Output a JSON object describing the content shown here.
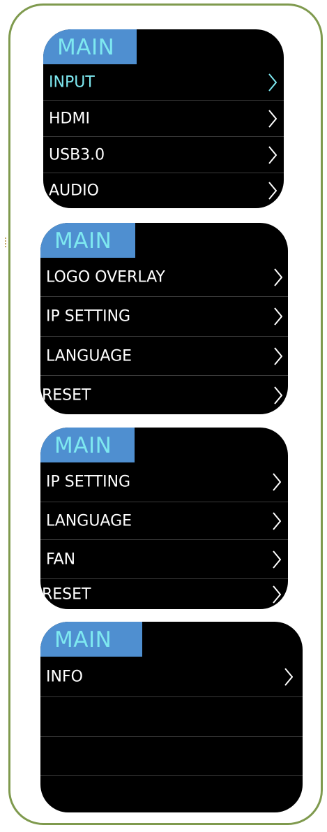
{
  "screens": [
    {
      "title": "MAIN",
      "items": [
        {
          "label": "INPUT",
          "highlight": true
        },
        {
          "label": "HDMI"
        },
        {
          "label": "USB3.0"
        },
        {
          "label": "AUDIO"
        }
      ]
    },
    {
      "title": "MAIN",
      "items": [
        {
          "label": "LOGO OVERLAY"
        },
        {
          "label": "IP SETTING"
        },
        {
          "label": "LANGUAGE"
        },
        {
          "label": "RESET"
        }
      ]
    },
    {
      "title": "MAIN",
      "items": [
        {
          "label": "IP SETTING"
        },
        {
          "label": "LANGUAGE"
        },
        {
          "label": "FAN"
        },
        {
          "label": "RESET"
        }
      ]
    },
    {
      "title": "MAIN",
      "items": [
        {
          "label": "INFO"
        },
        {
          "label": ""
        },
        {
          "label": ""
        },
        {
          "label": ""
        }
      ]
    }
  ],
  "colors": {
    "frame_border": "#7f9a4e",
    "screen_bg": "#000000",
    "tab_bg": "#4f8fd0",
    "tab_text": "#7ee8f0",
    "highlight_text": "#7ee8f0",
    "item_text": "#ffffff",
    "divider": "#3a3a3a"
  }
}
